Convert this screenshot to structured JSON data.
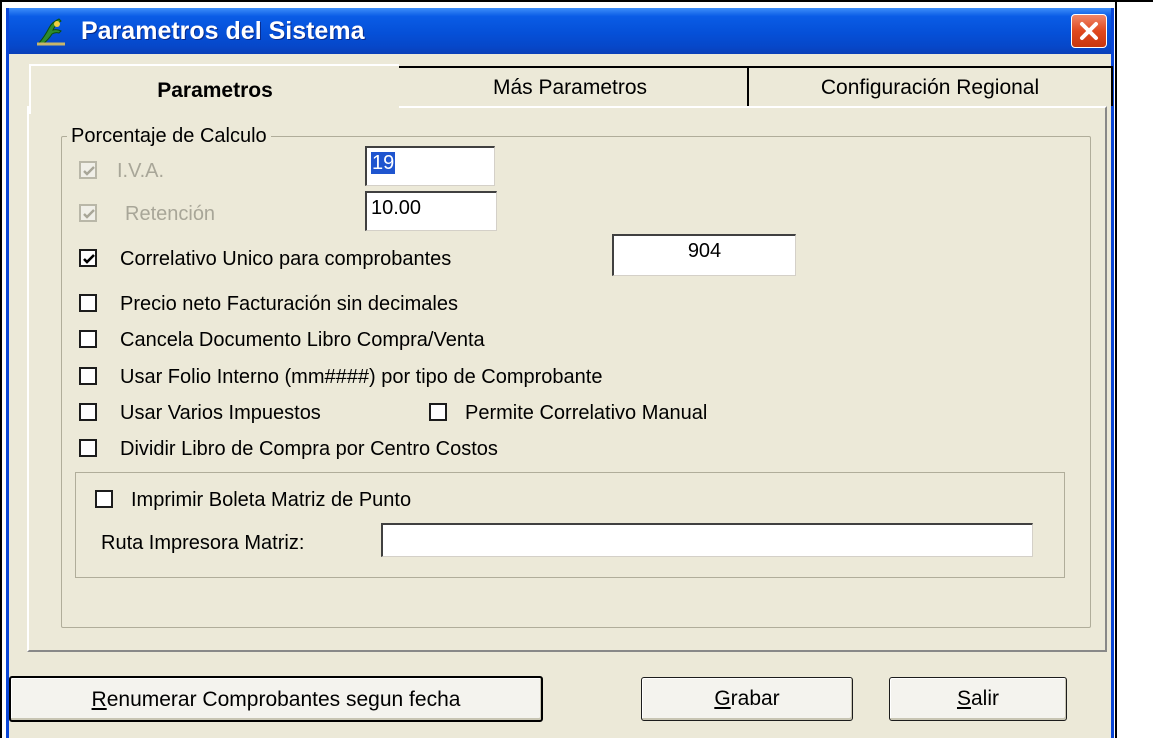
{
  "window": {
    "title": "Parametros del Sistema",
    "app_icon": "tree-icon",
    "close_icon": "close-icon"
  },
  "tabs": [
    {
      "label": "Parametros",
      "active": true
    },
    {
      "label": "Más Parametros",
      "active": false
    },
    {
      "label": "Configuración Regional",
      "active": false
    }
  ],
  "group": {
    "legend": "Porcentaje de Calculo",
    "iva": {
      "label": "I.V.A.",
      "checked": true,
      "enabled": false,
      "value": "19"
    },
    "retencion": {
      "label": "Retención",
      "checked": true,
      "enabled": false,
      "value": "10.00"
    },
    "correlativo": {
      "label": "Correlativo Unico para comprobantes",
      "checked": true,
      "value": "904"
    },
    "precio_neto": {
      "label": "Precio neto Facturación sin decimales",
      "checked": false
    },
    "cancela_doc": {
      "label": "Cancela Documento Libro Compra/Venta",
      "checked": false
    },
    "folio_interno": {
      "label": "Usar Folio Interno (mm####) por tipo de Comprobante",
      "checked": false
    },
    "varios_impuestos": {
      "label": "Usar Varios Impuestos",
      "checked": false
    },
    "correlativo_manual": {
      "label": "Permite Correlativo Manual",
      "checked": false
    },
    "dividir_libro": {
      "label": "Dividir Libro de Compra por Centro Costos",
      "checked": false
    },
    "imprimir_boleta": {
      "label": "Imprimir Boleta Matriz de Punto",
      "checked": false
    },
    "ruta_label": "Ruta Impresora Matriz:",
    "ruta_value": ""
  },
  "buttons": {
    "renumerar": {
      "mnemonic": "R",
      "rest": "enumerar Comprobantes segun fecha"
    },
    "grabar": {
      "mnemonic": "G",
      "rest": "rabar"
    },
    "salir": {
      "mnemonic": "S",
      "rest": "alir"
    }
  },
  "colors": {
    "titlebar": "#0550d8",
    "dialog_bg": "#ece9d8",
    "close_button": "#e0491f",
    "selection": "#1f55cf"
  }
}
